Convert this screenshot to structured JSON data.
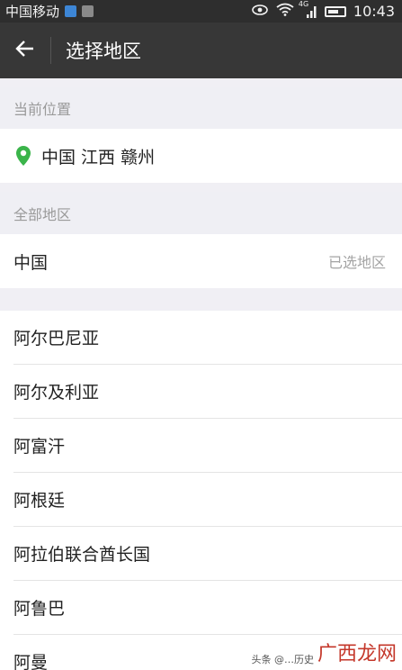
{
  "status_bar": {
    "carrier": "中国移动",
    "network": "4G",
    "time": "10:43"
  },
  "header": {
    "title": "选择地区"
  },
  "current_location": {
    "section_label": "当前位置",
    "value": "中国 江西 赣州"
  },
  "all_regions": {
    "section_label": "全部地区",
    "selected_country": "中国",
    "selected_tag": "已选地区"
  },
  "countries": [
    "阿尔巴尼亚",
    "阿尔及利亚",
    "阿富汗",
    "阿根廷",
    "阿拉伯联合酋长国",
    "阿鲁巴",
    "阿曼"
  ],
  "watermark": {
    "logo_text": "广西龙网",
    "caption": "头条 @…历史"
  },
  "colors": {
    "app_bar": "#373737",
    "status_bar": "#2e2e2e",
    "pin": "#3ab44a",
    "background": "#efeff4"
  }
}
